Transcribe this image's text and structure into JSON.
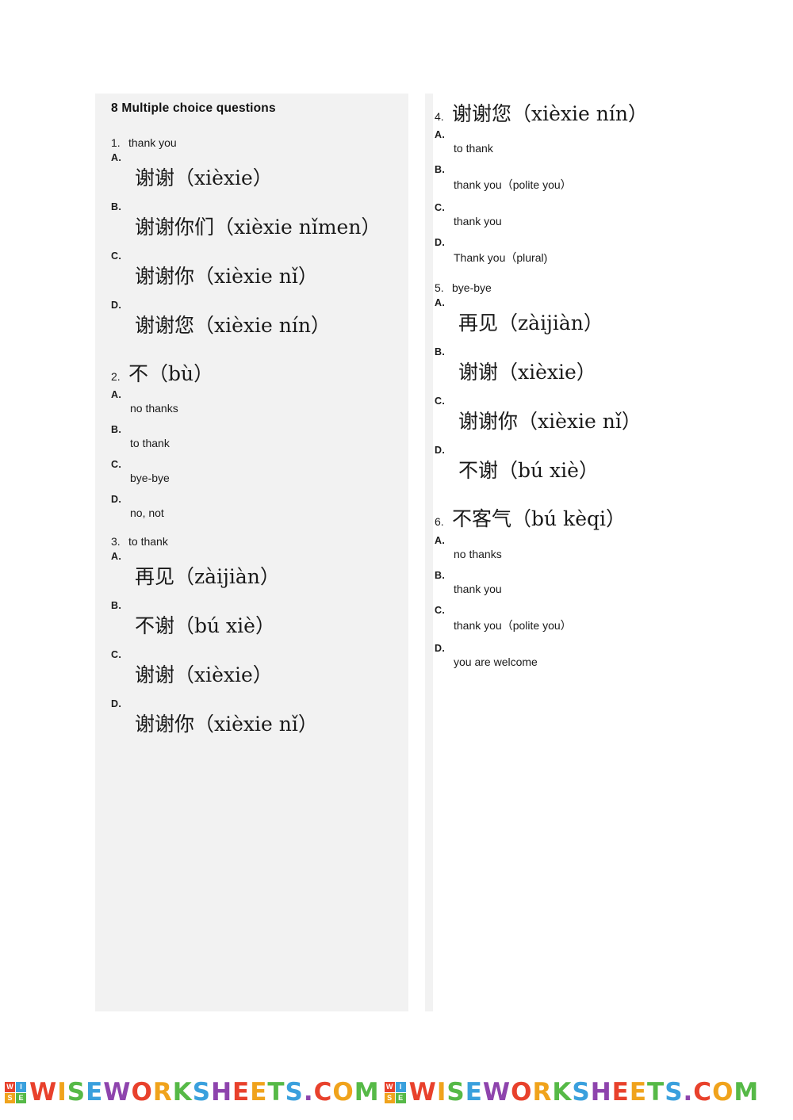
{
  "title": "8 Multiple choice questions",
  "questions_left": [
    {
      "num": "1.",
      "prompt": "thank you",
      "prompt_type": "plain",
      "options": [
        {
          "letter": "A.",
          "text": "谢谢（xièxie）",
          "type": "cn"
        },
        {
          "letter": "B.",
          "text": "谢谢你们（xièxie nǐmen）",
          "type": "cn"
        },
        {
          "letter": "C.",
          "text": "谢谢你（xièxie nǐ）",
          "type": "cn"
        },
        {
          "letter": "D.",
          "text": "谢谢您（xièxie nín）",
          "type": "cn"
        }
      ]
    },
    {
      "num": "2.",
      "prompt": "不（bù）",
      "prompt_type": "cn",
      "options": [
        {
          "letter": "A.",
          "text": "no thanks",
          "type": "plain"
        },
        {
          "letter": "B.",
          "text": "to thank",
          "type": "plain"
        },
        {
          "letter": "C.",
          "text": "bye-bye",
          "type": "plain"
        },
        {
          "letter": "D.",
          "text": "no,  not",
          "type": "plain"
        }
      ]
    },
    {
      "num": "3.",
      "prompt": "to thank",
      "prompt_type": "plain",
      "options": [
        {
          "letter": "A.",
          "text": "再见（zàijiàn）",
          "type": "cn"
        },
        {
          "letter": "B.",
          "text": "不谢（bú xiè）",
          "type": "cn"
        },
        {
          "letter": "C.",
          "text": "谢谢（xièxie）",
          "type": "cn"
        },
        {
          "letter": "D.",
          "text": "谢谢你（xièxie nǐ）",
          "type": "cn"
        }
      ]
    }
  ],
  "questions_right": [
    {
      "num": "4.",
      "prompt": "谢谢您（xièxie nín）",
      "prompt_type": "cn",
      "options": [
        {
          "letter": "A.",
          "text": "to thank",
          "type": "plain"
        },
        {
          "letter": "B.",
          "text": "thank you（polite you）",
          "type": "plain"
        },
        {
          "letter": "C.",
          "text": "thank you",
          "type": "plain"
        },
        {
          "letter": "D.",
          "text": "Thank you（plural)",
          "type": "plain"
        }
      ]
    },
    {
      "num": "5.",
      "prompt": "bye-bye",
      "prompt_type": "plain",
      "options": [
        {
          "letter": "A.",
          "text": "再见（zàijiàn）",
          "type": "cn"
        },
        {
          "letter": "B.",
          "text": "谢谢（xièxie）",
          "type": "cn"
        },
        {
          "letter": "C.",
          "text": "谢谢你（xièxie nǐ）",
          "type": "cn"
        },
        {
          "letter": "D.",
          "text": "不谢（bú xiè）",
          "type": "cn"
        }
      ]
    },
    {
      "num": "6.",
      "prompt": "不客气（bú kèqi）",
      "prompt_type": "cn",
      "options": [
        {
          "letter": "A.",
          "text": "no thanks",
          "type": "plain"
        },
        {
          "letter": "B.",
          "text": "thank you",
          "type": "plain"
        },
        {
          "letter": "C.",
          "text": "thank you（polite you）",
          "type": "plain"
        },
        {
          "letter": "D.",
          "text": "you are welcome",
          "type": "plain"
        }
      ]
    }
  ],
  "footer": {
    "watermark_text": "WISEWORKSHEETS.COM",
    "logo_letters": [
      "W",
      "I",
      "S",
      "E"
    ]
  },
  "colors": {
    "band": "#f2f2f2",
    "text": "#1a1a1a",
    "wm_red": "#e8412c",
    "wm_blue": "#3aa0dd",
    "wm_orange": "#f0a31c",
    "wm_green": "#56b947",
    "wm_purple": "#8e44ad"
  }
}
